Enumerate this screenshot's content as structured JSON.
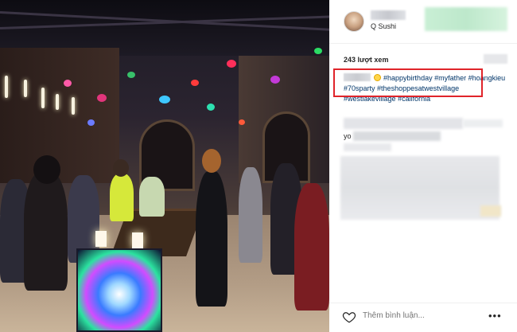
{
  "post": {
    "location": "Q Sushi",
    "views": "243 lượt xem",
    "caption_parts": {
      "t1": "#happybirthday",
      "t2": "#myfather",
      "t3": "#hoangkieu",
      "t4": "#70sparty",
      "t5": "#theshoppesatwestvillage",
      "t6": "#westlakevillage",
      "t7": "#california"
    },
    "comment_prefix": "yo"
  },
  "comment_bar": {
    "placeholder": "Thêm bình luận...",
    "more_label": "•••"
  },
  "colors": {
    "hashtag": "#003569",
    "highlight_box": "#e0242a",
    "text": "#262626"
  },
  "icons": [
    "heart-icon",
    "more-options-icon"
  ]
}
